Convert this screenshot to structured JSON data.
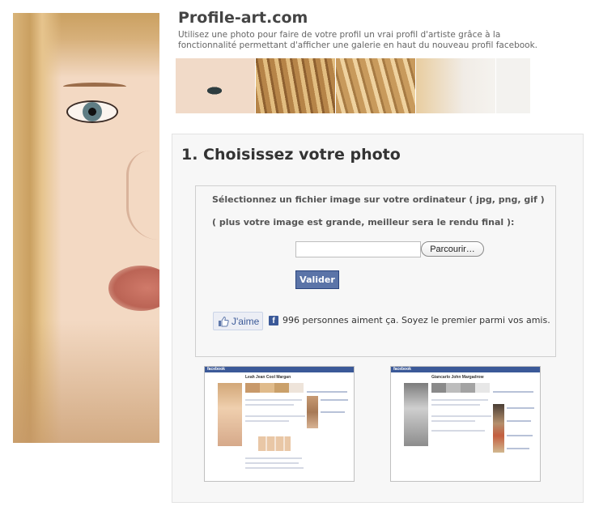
{
  "header": {
    "title": "Profile-art.com",
    "subtitle": "Utilisez une photo pour faire de votre profil un vrai profil d'artiste grâce à la fonctionnalité permettant d'afficher une galerie en haut du nouveau profil facebook."
  },
  "step": {
    "title": "1. Choisissez votre photo"
  },
  "upload": {
    "instruction_1": "Sélectionnez un fichier image sur votre ordinateur ( jpg, png, gif )",
    "instruction_2": "( plus votre image est grande, meilleur sera le rendu final ):",
    "file_value": "",
    "browse_label": "Parcourir…",
    "submit_label": "Valider"
  },
  "like": {
    "button_label": "J'aime",
    "count_text": "996 personnes aiment ça. Soyez le premier parmi vos amis.",
    "facebook_icon": "f"
  },
  "examples": {
    "example_1_name": "Leah Jean Cool Margan",
    "example_2_name": "Giancarlo John Margadrow",
    "brand_text": "facebook"
  },
  "colors": {
    "facebook_blue": "#3b5998",
    "submit_bg": "#5b74a8",
    "like_bg": "#eceef5"
  }
}
